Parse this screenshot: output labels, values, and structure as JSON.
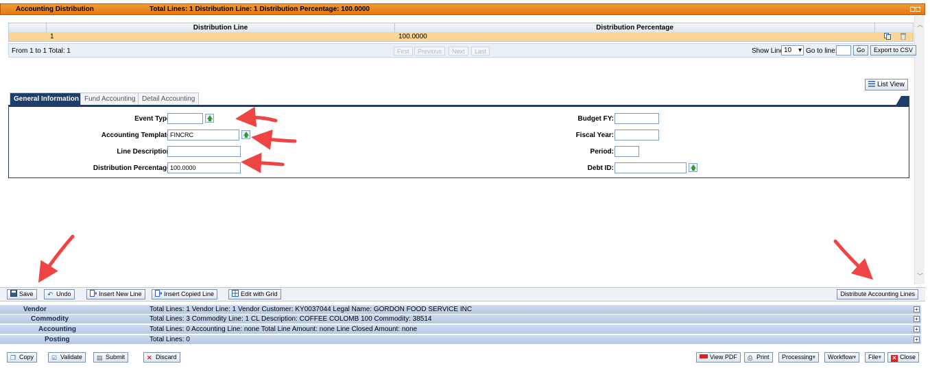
{
  "header": {
    "title": "Accounting Distribution",
    "summary": "Total Lines: 1   Distribution Line: 1   Distribution Percentage: 100.0000"
  },
  "grid": {
    "columns": [
      "Distribution Line",
      "Distribution Percentage"
    ],
    "rows": [
      {
        "line": "1",
        "percentage": "100.0000"
      }
    ]
  },
  "pager": {
    "range": "From 1 to 1 Total: 1",
    "first": "First",
    "previous": "Previous",
    "next": "Next",
    "last": "Last",
    "show_lines_label": "Show Lines:",
    "show_lines_value": "10",
    "go_to_label": "Go to line:",
    "go": "Go",
    "export": "Export to CSV"
  },
  "list_view": "List View",
  "tabs": [
    "General Information",
    "Fund Accounting",
    "Detail Accounting"
  ],
  "form": {
    "event_type_label": "Event Type:",
    "event_type_value": "",
    "template_label": "Accounting Template:",
    "template_value": "FINCRC",
    "line_desc_label": "Line Description:",
    "line_desc_value": "",
    "dist_pct_label": "Distribution Percentage:",
    "dist_pct_value": "100.0000",
    "budget_fy_label": "Budget FY:",
    "fiscal_year_label": "Fiscal Year:",
    "period_label": "Period:",
    "debt_id_label": "Debt ID:"
  },
  "toolbar": {
    "save": "Save",
    "undo": "Undo",
    "insert_new": "Insert New Line",
    "insert_copied": "Insert Copied Line",
    "edit_grid": "Edit with Grid",
    "distribute": "Distribute Accounting Lines"
  },
  "sections": [
    {
      "name": "Vendor",
      "details": "Total Lines: 1   Vendor Line: 1   Vendor Customer: KY0037044   Legal Name: GORDON FOOD SERVICE INC"
    },
    {
      "name": "Commodity",
      "details": "Total Lines: 3   Commodity Line: 1   CL Description: COFFEE COLOMB 100   Commodity: 38514"
    },
    {
      "name": "Accounting",
      "details": "Total Lines: 0   Accounting Line: none   Total Line Amount: none   Line Closed Amount: none"
    },
    {
      "name": "Posting",
      "details": "Total Lines: 0"
    }
  ],
  "footer": {
    "copy": "Copy",
    "validate": "Validate",
    "submit": "Submit",
    "discard": "Discard",
    "view_pdf": "View PDF",
    "print": "Print",
    "processing": "Processing",
    "workflow": "Workflow",
    "file": "File",
    "close": "Close"
  },
  "colors": {
    "header": "#e3780f",
    "selected_row": "#fcd694",
    "tab_active": "#1d3e6b",
    "arrow": "#ef4444"
  }
}
